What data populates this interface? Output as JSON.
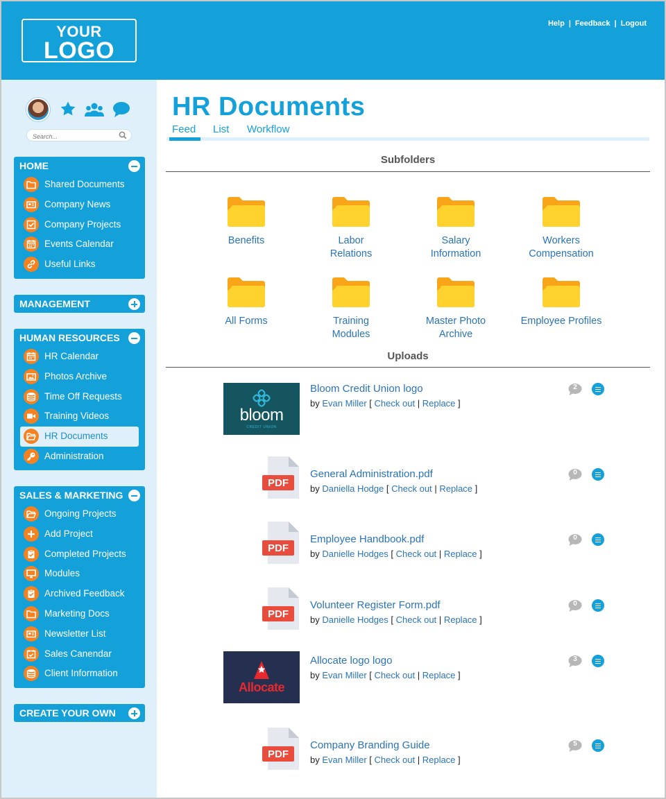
{
  "header": {
    "logo_line1": "YOUR",
    "logo_line2": "LOGO",
    "help": "Help",
    "feedback": "Feedback",
    "logout": "Logout",
    "sep": "|"
  },
  "sidebar": {
    "search_placeholder": "Search...",
    "panels": {
      "home": {
        "title": "HOME",
        "items": [
          "Shared Documents",
          "Company News",
          "Company Projects",
          "Events Calendar",
          "Useful Links"
        ]
      },
      "management": {
        "title": "MANAGEMENT"
      },
      "hr": {
        "title": "HUMAN RESOURCES",
        "items": [
          "HR Calendar",
          "Photos Archive",
          "Time Off Requests",
          "Training Videos",
          "HR Documents",
          "Administration"
        ]
      },
      "sales": {
        "title": "SALES & MARKETING",
        "items": [
          "Ongoing Projects",
          "Add Project",
          "Completed Projects",
          "Modules",
          "Archived Feedback",
          "Marketing Docs",
          "Newsletter List",
          "Sales Canendar",
          "Client Information"
        ]
      },
      "create": {
        "title": "CREATE YOUR OWN"
      }
    }
  },
  "main": {
    "title": "HR Documents",
    "tabs": [
      "Feed",
      "List",
      "Workflow"
    ],
    "subfolders_heading": "Subfolders",
    "folders": [
      [
        "Benefits"
      ],
      [
        "Labor",
        "Relations"
      ],
      [
        "Salary",
        "Information"
      ],
      [
        "Workers",
        "Compensation"
      ],
      [
        "All Forms"
      ],
      [
        "Training",
        "Modules"
      ],
      [
        "Master Photo",
        "Archive"
      ],
      [
        "Employee Profiles"
      ]
    ],
    "uploads_heading": "Uploads",
    "by": "by",
    "check_out": "Check out",
    "replace": "Replace",
    "lbr": "[",
    "rbr": "]",
    "bar": "|",
    "uploads": [
      {
        "name": "Bloom Credit Union logo",
        "author": "Evan Miller",
        "comments": "2",
        "thumb": "bloom"
      },
      {
        "name": "General Administration.pdf",
        "author": "Daniella Hodge",
        "comments": "0",
        "thumb": "pdf"
      },
      {
        "name": "Employee Handbook.pdf",
        "author": "Danielle Hodges",
        "comments": "0",
        "thumb": "pdf"
      },
      {
        "name": "Volunteer Register Form.pdf",
        "author": "Danielle Hodges",
        "comments": "0",
        "thumb": "pdf"
      },
      {
        "name": "Allocate logo logo",
        "author": "Evan Miller",
        "comments": "3",
        "thumb": "allocate"
      },
      {
        "name": "Company Branding Guide",
        "author": "Evan Miller",
        "comments": "5",
        "thumb": "pdf"
      }
    ],
    "pdf_label": "PDF",
    "bloom_word": "bloom",
    "bloom_sub": "CREDIT UNION",
    "allocate_word": "Allocate"
  },
  "colors": {
    "brand_blue": "#14a0d8",
    "orange": "#f58220",
    "link": "#2a74b7",
    "sidebar_bg": "#dff0fa"
  }
}
